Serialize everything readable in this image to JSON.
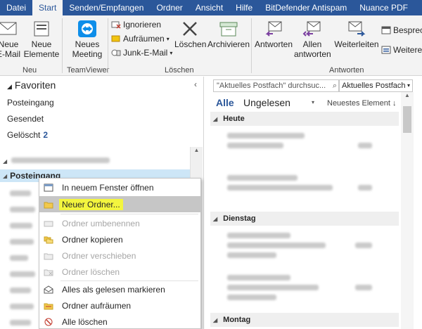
{
  "tabs": [
    "Datei",
    "Start",
    "Senden/Empfangen",
    "Ordner",
    "Ansicht",
    "Hilfe",
    "BitDefender Antispam",
    "Nuance PDF"
  ],
  "ribbon": {
    "new_email": {
      "line1": "Neue",
      "line2": "E-Mail"
    },
    "new_items": {
      "line1": "Neue",
      "line2": "Elemente"
    },
    "group_new": "Neu",
    "new_meeting": {
      "line1": "Neues",
      "line2": "Meeting"
    },
    "group_teamviewer": "TeamViewer",
    "ignore": "Ignorieren",
    "cleanup": "Aufräumen",
    "junk": "Junk-E-Mail",
    "delete": "Löschen",
    "archive": "Archivieren",
    "group_delete": "Löschen",
    "reply": "Antworten",
    "reply_all": {
      "line1": "Allen",
      "line2": "antworten"
    },
    "forward": "Weiterleiten",
    "meeting_partial": "Besprech",
    "more_partial": "Weitere",
    "group_reply": "Antworten"
  },
  "folders": {
    "favorites_title": "Favoriten",
    "items": [
      {
        "label": "Posteingang",
        "count": ""
      },
      {
        "label": "Gesendet",
        "count": ""
      },
      {
        "label": "Gelöscht",
        "count": "2"
      }
    ],
    "account_inbox": "Posteingang"
  },
  "context_menu": [
    {
      "label": "In neuem Fenster öffnen",
      "disabled": false,
      "highlight": false
    },
    {
      "label": "Neuer Ordner...",
      "disabled": false,
      "highlight": true
    },
    {
      "label": "Ordner umbenennen",
      "disabled": true,
      "highlight": false
    },
    {
      "label": "Ordner kopieren",
      "disabled": false,
      "highlight": false
    },
    {
      "label": "Ordner verschieben",
      "disabled": true,
      "highlight": false
    },
    {
      "label": "Ordner löschen",
      "disabled": true,
      "highlight": false
    },
    {
      "label": "Alles als gelesen markieren",
      "disabled": false,
      "highlight": false
    },
    {
      "label": "Ordner aufräumen",
      "disabled": false,
      "highlight": false
    },
    {
      "label": "Alle löschen",
      "disabled": false,
      "highlight": false
    }
  ],
  "mail": {
    "search_placeholder": "\"Aktuelles Postfach\" durchsuc...",
    "scope": "Aktuelles Postfach",
    "filter_all": "Alle",
    "filter_unread": "Ungelesen",
    "sort": "Neuestes Element",
    "groups": [
      "Heute",
      "Dienstag",
      "Montag"
    ]
  },
  "colors": {
    "accent": "#2b579a",
    "highlight_marker": "#f3f53e"
  }
}
